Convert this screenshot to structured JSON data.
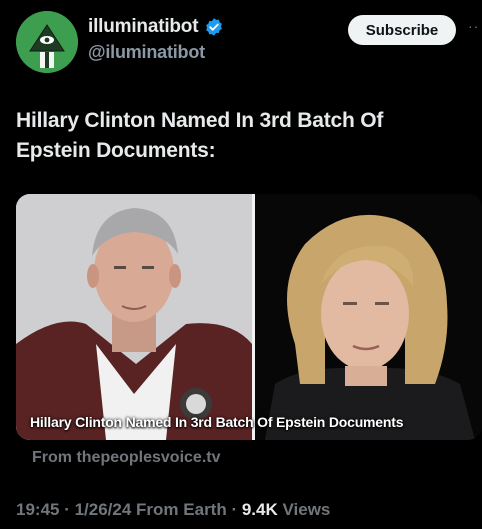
{
  "user": {
    "display_name": "illuminatibot",
    "handle": "@iluminatibot",
    "verified_icon": "verified-badge-icon"
  },
  "actions": {
    "subscribe_label": "Subscribe",
    "more_icon": "more-dots-icon"
  },
  "tweet": {
    "text": "Hillary Clinton Named In 3rd Batch Of Epstein Documents:"
  },
  "card": {
    "caption": "Hillary Clinton Named In 3rd Batch Of Epstein Documents",
    "source": "From thepeoplesvoice.tv"
  },
  "meta": {
    "time": "19:45",
    "sep1": " · ",
    "date": "1/26/24",
    "sep2": " From Earth · ",
    "views_count": "9.4K",
    "views_label": " Views"
  },
  "colors": {
    "background": "#000000",
    "text_primary": "#e7e9ea",
    "text_secondary": "#71767b",
    "verified_blue": "#1d9bf0",
    "subscribe_bg": "#eff3f4"
  }
}
